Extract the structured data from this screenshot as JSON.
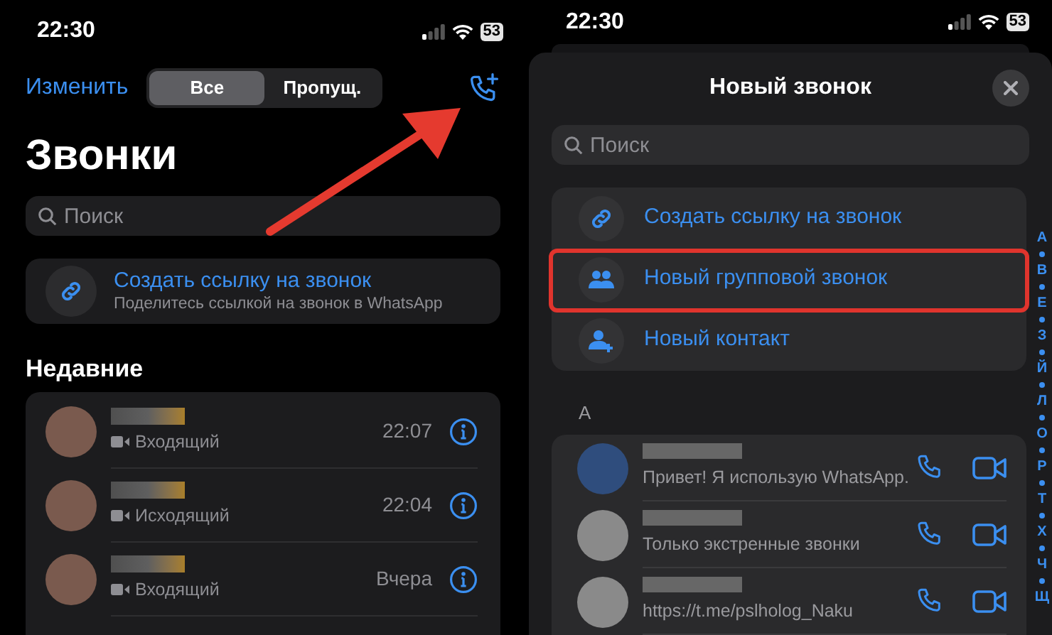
{
  "left_screen": {
    "status_bar": {
      "time": "22:30",
      "battery": "53"
    },
    "toolbar": {
      "edit": "Изменить",
      "segments": [
        {
          "label": "Все",
          "selected": true
        },
        {
          "label": "Пропущ.",
          "selected": false
        }
      ]
    },
    "title": "Звонки",
    "search": {
      "placeholder": "Поиск"
    },
    "link_card": {
      "title": "Создать ссылку на звонок",
      "subtitle": "Поделитесь ссылкой на звонок в WhatsApp"
    },
    "section_title": "Недавние",
    "calls": [
      {
        "kind": "video",
        "direction": "Входящий",
        "time": "22:07"
      },
      {
        "kind": "video",
        "direction": "Исходящий",
        "time": "22:04"
      },
      {
        "kind": "video",
        "direction": "Входящий",
        "time": "Вчера"
      }
    ]
  },
  "right_screen": {
    "status_bar": {
      "time": "22:30",
      "battery": "53"
    },
    "sheet_title": "Новый звонок",
    "search": {
      "placeholder": "Поиск"
    },
    "actions": [
      {
        "kind": "link",
        "label": "Создать ссылку на звонок",
        "highlighted": false
      },
      {
        "kind": "group",
        "label": "Новый групповой звонок",
        "highlighted": true
      },
      {
        "kind": "contact",
        "label": "Новый контакт",
        "highlighted": false
      }
    ],
    "section_letter": "А",
    "contacts": [
      {
        "status": "Привет! Я использую WhatsApp."
      },
      {
        "status": "Только экстренные звонки"
      },
      {
        "status": "https://t.me/pslholog_Naku"
      }
    ],
    "index_letters": [
      "А",
      "В",
      "Е",
      "З",
      "Й",
      "Л",
      "О",
      "Р",
      "Т",
      "Х",
      "Ч",
      "Щ"
    ]
  }
}
